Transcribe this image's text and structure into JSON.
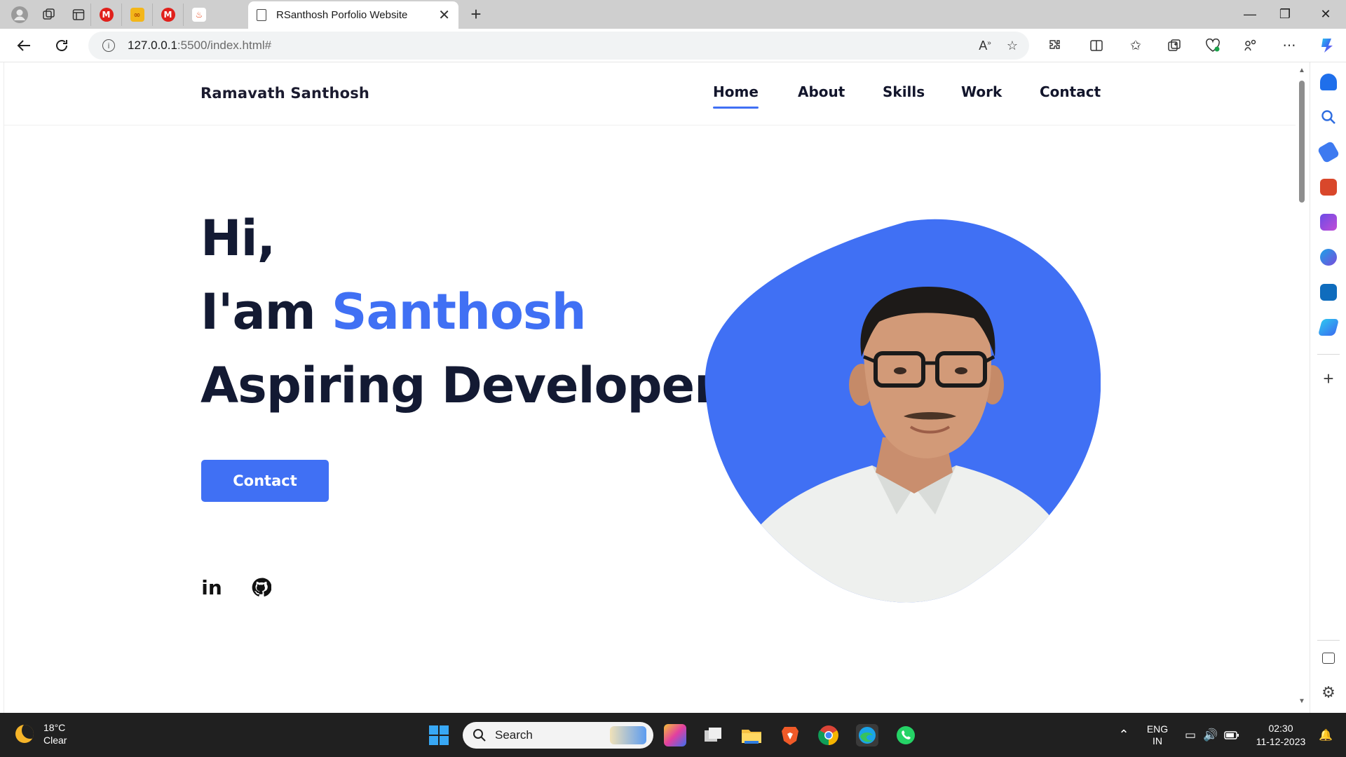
{
  "browser": {
    "tab_title": "RSanthosh Porfolio Website",
    "url_host": "127.0.0.1",
    "url_path": ":5500/index.html#"
  },
  "site": {
    "logo": "Ramavath Santhosh",
    "nav": [
      {
        "label": "Home",
        "active": true
      },
      {
        "label": "About",
        "active": false
      },
      {
        "label": "Skills",
        "active": false
      },
      {
        "label": "Work",
        "active": false
      },
      {
        "label": "Contact",
        "active": false
      }
    ],
    "hero": {
      "greeting": "Hi,",
      "intro_prefix": "I'am ",
      "name": "Santhosh",
      "role": "Aspiring Developer",
      "cta_label": "Contact"
    },
    "social": {
      "linkedin_glyph": "in"
    },
    "accent_color": "#4070f4"
  },
  "taskbar": {
    "weather_temp": "18°C",
    "weather_desc": "Clear",
    "search_label": "Search",
    "lang_1": "ENG",
    "lang_2": "IN",
    "time": "02:30",
    "date": "11-12-2023"
  }
}
